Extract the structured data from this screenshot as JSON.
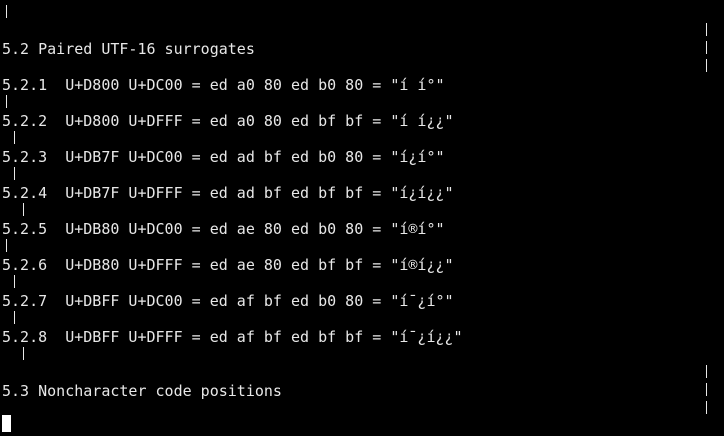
{
  "terminal": {
    "colors": {
      "background": "#000000",
      "foreground": "#e8e8e8",
      "cursor": "#ffffff"
    },
    "separator_glyph": "|",
    "lines": {
      "section_5_2": "5.2 Paired UTF-16 surrogates",
      "l521": "5.2.1  U+D800 U+DC00 = ed a0 80 ed b0 80 = \"í í°\"",
      "l522": "5.2.2  U+D800 U+DFFF = ed a0 80 ed bf bf = \"í í¿¿\"",
      "l523": "5.2.3  U+DB7F U+DC00 = ed ad bf ed b0 80 = \"í­¿í°\"",
      "l524": "5.2.4  U+DB7F U+DFFF = ed ad bf ed bf bf = \"í­¿í¿¿\"",
      "l525": "5.2.5  U+DB80 U+DC00 = ed ae 80 ed b0 80 = \"í®í°\"",
      "l526": "5.2.6  U+DB80 U+DFFF = ed ae 80 ed bf bf = \"í®í¿¿\"",
      "l527": "5.2.7  U+DBFF U+DC00 = ed af bf ed b0 80 = \"í¯¿í°\"",
      "l528": "5.2.8  U+DBFF U+DFFF = ed af bf ed bf bf = \"í¯¿í¿¿\"",
      "section_5_3": "5.3 Noncharacter code positions"
    }
  }
}
